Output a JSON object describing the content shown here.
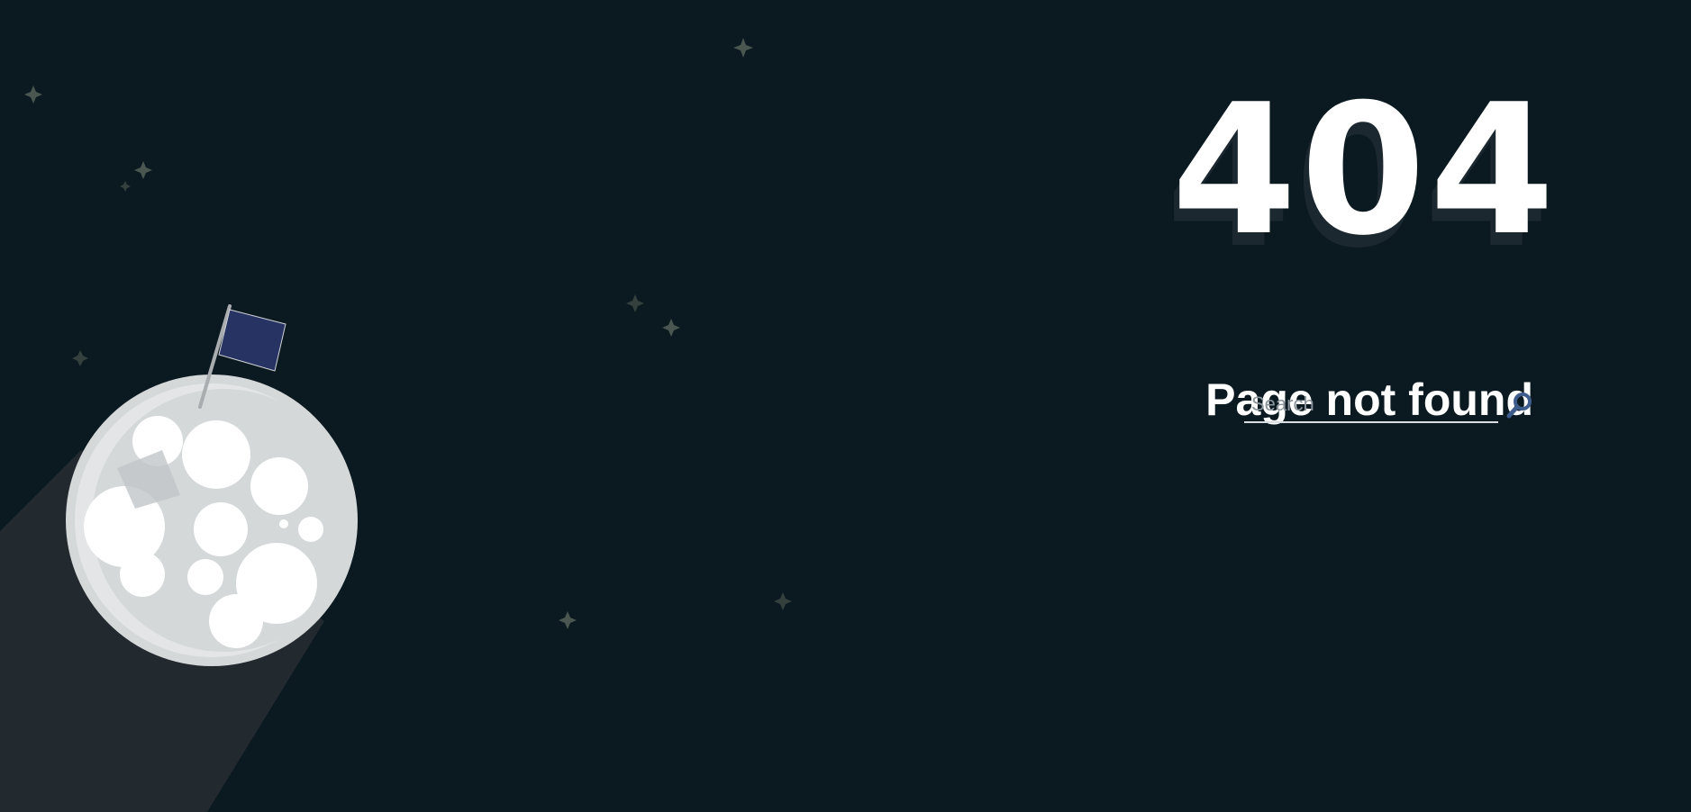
{
  "error_page": {
    "code": "404",
    "title": "Page not found"
  },
  "search": {
    "placeholder": "Search",
    "value": "",
    "button_icon": "search-icon"
  },
  "scene": {
    "illustration": "moon-with-flag-icon",
    "decoration": "star-icon"
  },
  "colors": {
    "background": "#0b1921",
    "text": "#ffffff",
    "moon": "#d5d8d9",
    "crater": "#ffffff",
    "flag": "#263363",
    "star": "#4a5650",
    "search_icon": "#3e5d8c",
    "shadow": "#22292f"
  }
}
